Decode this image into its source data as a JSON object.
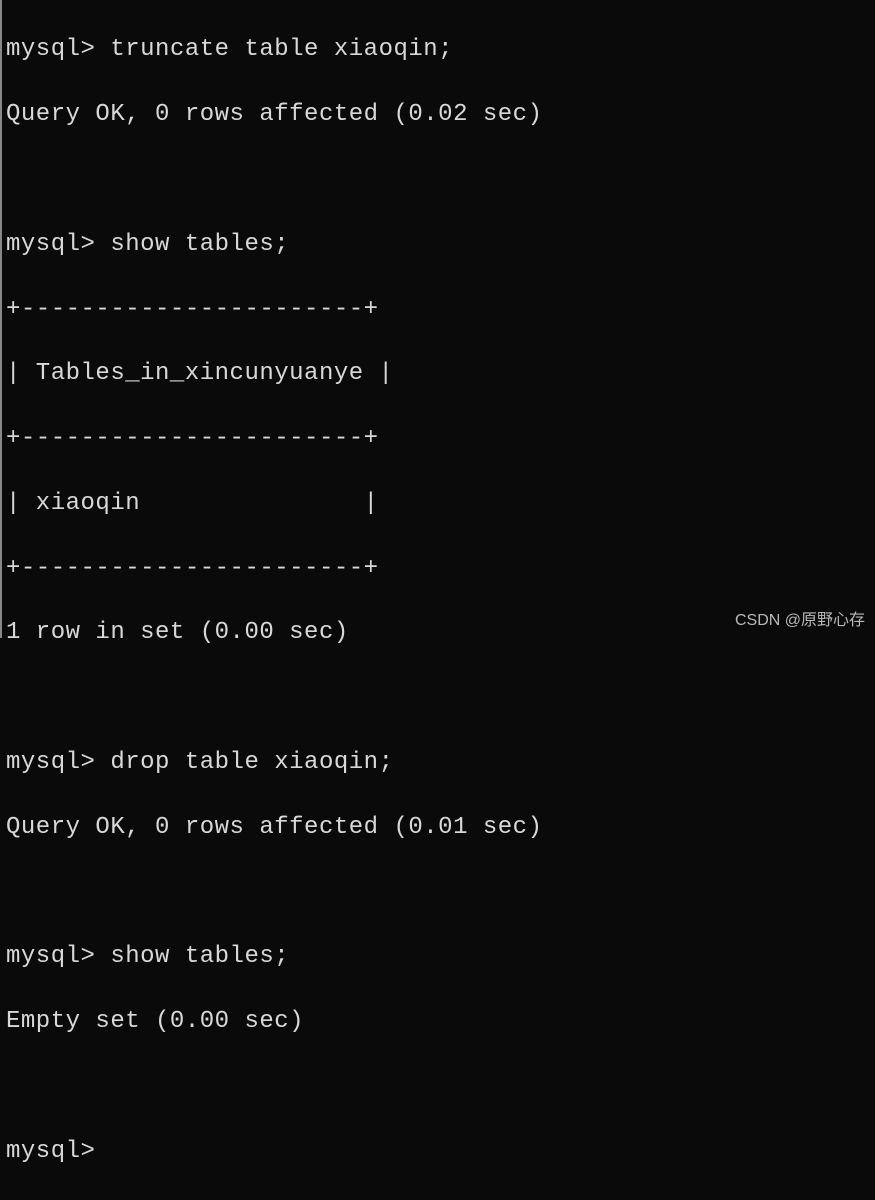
{
  "terminal": {
    "prompt": "mysql>",
    "cmd1": "truncate table xiaoqin;",
    "resp1": "Query OK, 0 rows affected (0.02 sec)",
    "cmd2": "show tables;",
    "table_border": "+-----------------------+",
    "table_header": "| Tables_in_xincunyuanye |",
    "table_row1": "| xiaoqin               |",
    "resp2": "1 row in set (0.00 sec)",
    "cmd3": "drop table xiaoqin;",
    "resp3": "Query OK, 0 rows affected (0.01 sec)",
    "cmd4": "show tables;",
    "resp4": "Empty set (0.00 sec)"
  },
  "watermark": "CSDN @原野心存"
}
